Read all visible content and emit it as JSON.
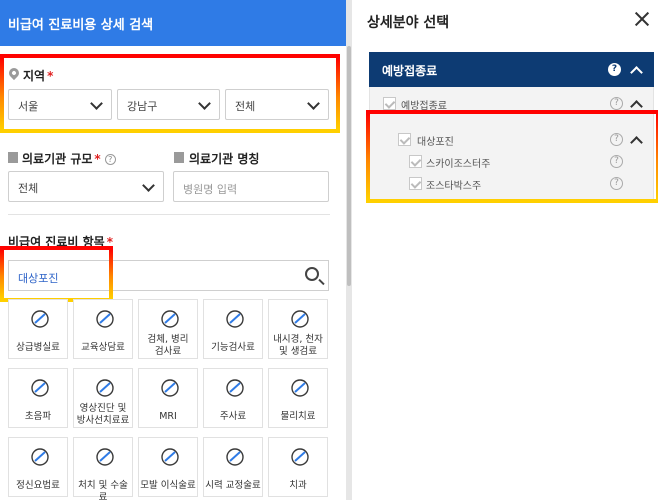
{
  "left_panel": {
    "header_title": "비급여 진료비용 상세 검색",
    "region": {
      "label": "지역",
      "required_mark": "*",
      "city": "서울",
      "district": "강남구",
      "dong": "전체"
    },
    "institution_size": {
      "label": "의료기관 규모",
      "required_mark": "*",
      "help": "?",
      "value": "전체"
    },
    "institution_name": {
      "label": "의료기관 명칭",
      "placeholder": "병원명 입력"
    },
    "item": {
      "label": "비급여 진료비 항목",
      "required_mark": "*",
      "search_value": "대상포진"
    },
    "categories": [
      {
        "label": "상급병실료",
        "icon": "hospital-bed-icon"
      },
      {
        "label": "교육상담료",
        "icon": "consultation-icon"
      },
      {
        "label": "검체, 병리\n검사료",
        "icon": "microscope-icon"
      },
      {
        "label": "기능검사료",
        "icon": "function-test-icon"
      },
      {
        "label": "내시경, 천자\n및 생검료",
        "icon": "endoscope-icon"
      },
      {
        "label": "초음파",
        "icon": "ultrasound-icon"
      },
      {
        "label": "영상진단 및\n방사선치료료",
        "icon": "xray-icon"
      },
      {
        "label": "MRI",
        "icon": "mri-icon"
      },
      {
        "label": "주사료",
        "icon": "syringe-icon"
      },
      {
        "label": "물리치료",
        "icon": "physiotherapy-icon"
      },
      {
        "label": "정신요법료",
        "icon": "brain-icon"
      },
      {
        "label": "처치 및 수술료",
        "icon": "surgery-icon"
      },
      {
        "label": "모발 이식술료",
        "icon": "hair-transplant-icon"
      },
      {
        "label": "시력 교정술료",
        "icon": "eye-icon"
      },
      {
        "label": "치과",
        "icon": "tooth-icon"
      }
    ]
  },
  "right_panel": {
    "title": "상세분야 선택",
    "section": {
      "title": "예방접종료",
      "help": "?",
      "group": {
        "label": "예방접종료",
        "help": "?",
        "subgroup": {
          "label": "대상포진",
          "help": "?",
          "items": [
            {
              "label": "스카이조스터주",
              "help": "?"
            },
            {
              "label": "조스타박스주",
              "help": "?"
            }
          ]
        }
      }
    }
  },
  "colors": {
    "header_blue": "#2f7be6",
    "section_navy": "#0d3b73",
    "required_red": "#e02020",
    "highlight_top": "#ff0000",
    "highlight_bottom": "#ffd000"
  }
}
